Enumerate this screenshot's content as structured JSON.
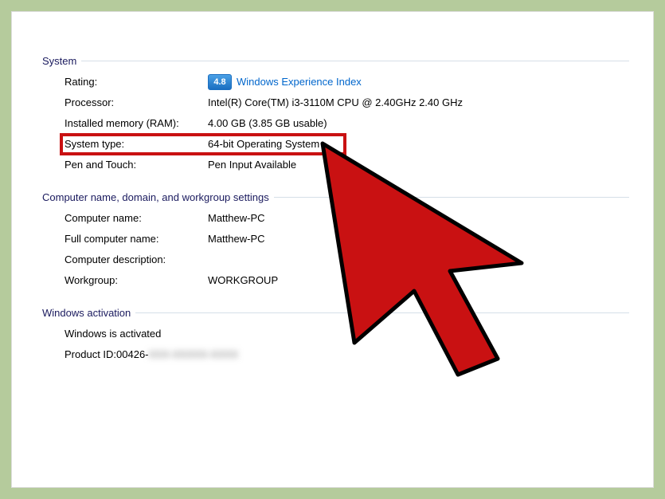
{
  "sections": {
    "system": {
      "title": "System",
      "rating_label": "Rating:",
      "rating_score": "4.8",
      "rating_link": "Windows Experience Index",
      "processor_label": "Processor:",
      "processor_value": "Intel(R) Core(TM) i3-3110M CPU @ 2.40GHz   2.40 GHz",
      "memory_label": "Installed memory (RAM):",
      "memory_value": "4.00 GB (3.85 GB usable)",
      "systype_label": "System type:",
      "systype_value": "64-bit Operating System",
      "pentouch_label": "Pen and Touch:",
      "pentouch_value": "Pen Input Available"
    },
    "computer": {
      "title": "Computer name, domain, and workgroup settings",
      "name_label": "Computer name:",
      "name_value": "Matthew-PC",
      "fullname_label": "Full computer name:",
      "fullname_value": "Matthew-PC",
      "desc_label": "Computer description:",
      "desc_value": "",
      "workgroup_label": "Workgroup:",
      "workgroup_value": "WORKGROUP"
    },
    "activation": {
      "title": "Windows activation",
      "status": "Windows is activated",
      "pid_label": "Product ID: ",
      "pid_prefix": "00426-",
      "pid_hidden": "XXX-XXXXX-XXXX"
    }
  }
}
